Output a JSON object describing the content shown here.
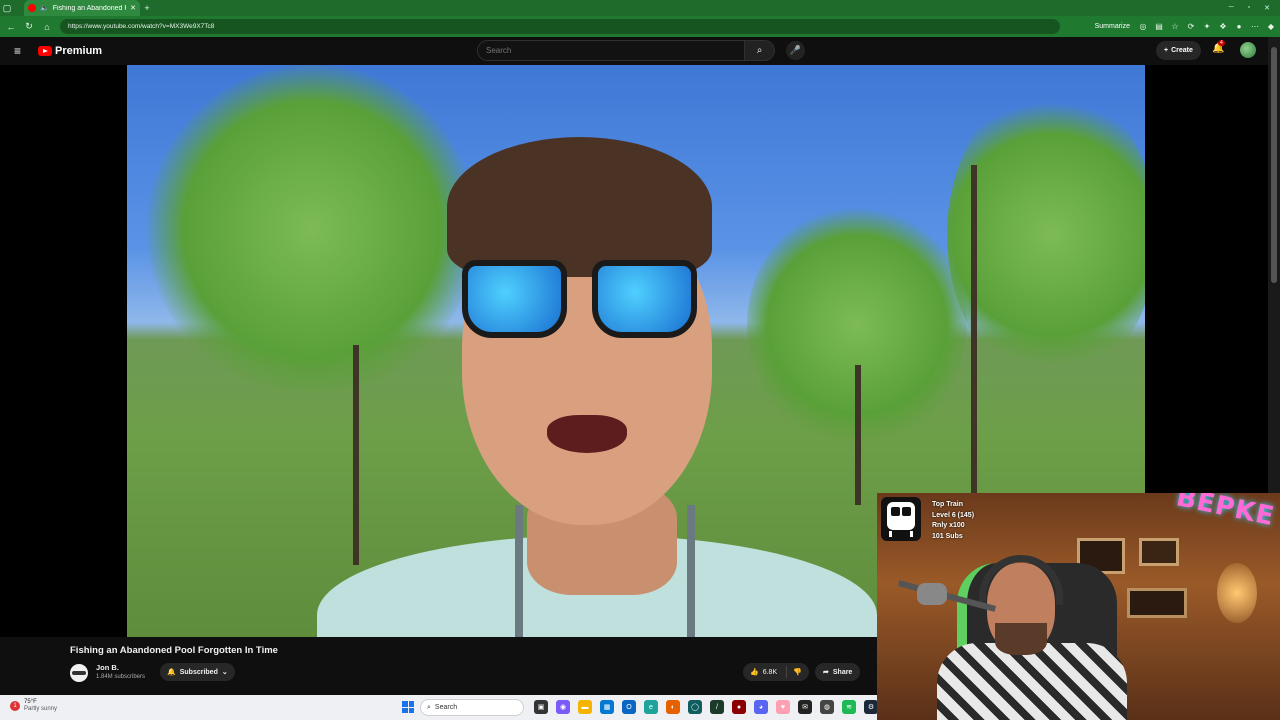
{
  "browser": {
    "tab_title": "Fishing an Abandoned Pool",
    "url": "https://www.youtube.com/watch?v=MX3We9X7Tc8",
    "summarize_label": "Summarize"
  },
  "youtube": {
    "logo_text": "Premium",
    "search_placeholder": "Search",
    "create_label": "Create",
    "notification_count": "4"
  },
  "video": {
    "title": "Fishing an Abandoned Pool Forgotten In Time",
    "channel_name": "Jon B.",
    "subscribers": "1.84M subscribers",
    "subscribed_label": "Subscribed",
    "likes": "6.8K",
    "share_label": "Share"
  },
  "taskbar": {
    "temperature": "75°F",
    "weather_condition": "Partly sunny",
    "search_placeholder": "Search"
  },
  "overlay": {
    "top_train_label": "Top Train",
    "level_text": "Level 6  (145)",
    "multiplier_text": "Rnly x100",
    "subs_text": "101 Subs",
    "sign_text": "BEPKE"
  },
  "colors": {
    "browser_green": "#1f7a30",
    "youtube_red": "#ff0000",
    "background": "#0f0f0f"
  }
}
